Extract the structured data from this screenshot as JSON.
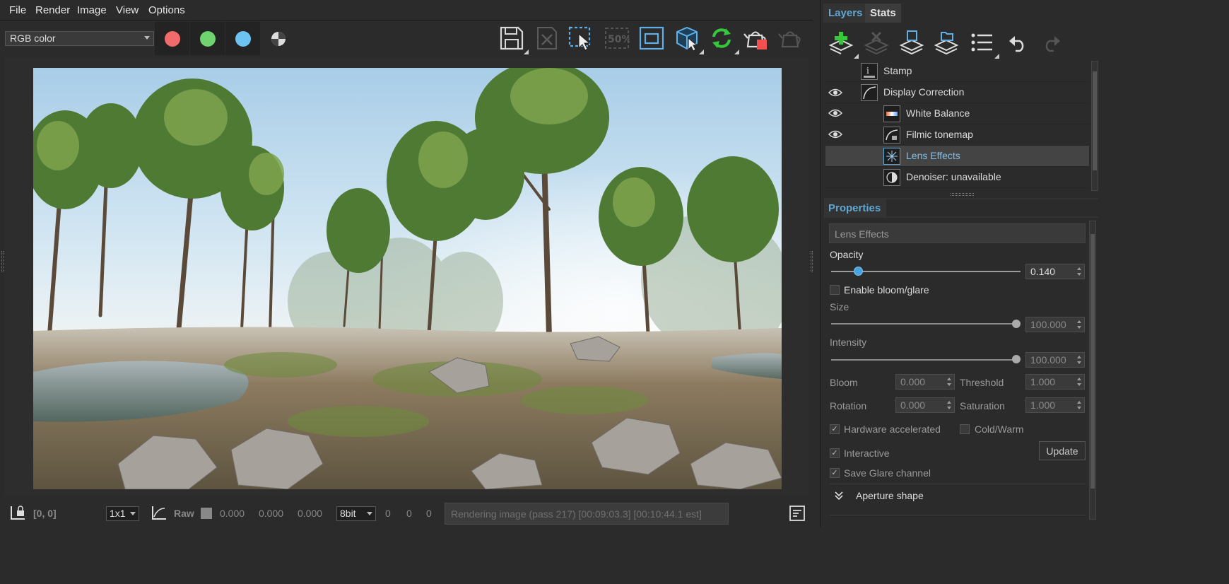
{
  "menu": [
    "File",
    "Render",
    "Image",
    "View",
    "Options"
  ],
  "toolbar": {
    "channel_select": "RGB color",
    "swatches": [
      {
        "name": "red-channel",
        "color": "#f26b6b"
      },
      {
        "name": "green-channel",
        "color": "#6fd36f"
      },
      {
        "name": "blue-channel",
        "color": "#6cc3f2"
      }
    ],
    "icons": [
      "save-icon",
      "discard-icon",
      "region-select-icon",
      "zoom-50-icon",
      "frame-icon",
      "pick-material-icon",
      "refresh-icon",
      "teapot-stop-icon",
      "teapot-icon"
    ],
    "zoom_label": "50%"
  },
  "status": {
    "coords": "[0, 0]",
    "scale": "1x1",
    "raw_label": "Raw",
    "raw_values": [
      "0.000",
      "0.000",
      "0.000"
    ],
    "depth": "8bit",
    "pixel_values": [
      "0",
      "0",
      "0"
    ],
    "progress_text": "Rendering image (pass 217) [00:09:03.3] [00:10:44.1 est]"
  },
  "panel": {
    "tabs": [
      "Layers",
      "Stats"
    ],
    "layer_tools": [
      "add-layer-icon",
      "delete-layer-icon",
      "save-layers-icon",
      "load-layers-icon",
      "layer-list-icon",
      "undo-icon",
      "redo-icon"
    ],
    "layers": [
      {
        "label": "Stamp",
        "indent": 0,
        "visible": false,
        "selected": false,
        "icon": "info-icon"
      },
      {
        "label": "Display Correction",
        "indent": 0,
        "visible": true,
        "selected": false,
        "icon": "curve-icon"
      },
      {
        "label": "White Balance",
        "indent": 1,
        "visible": true,
        "selected": false,
        "icon": "gradient-icon"
      },
      {
        "label": "Filmic tonemap",
        "indent": 1,
        "visible": true,
        "selected": false,
        "icon": "tonemap-icon"
      },
      {
        "label": "Lens Effects",
        "indent": 1,
        "visible": false,
        "selected": true,
        "icon": "sparkle-icon"
      },
      {
        "label": "Denoiser: unavailable",
        "indent": 1,
        "visible": false,
        "selected": false,
        "icon": "denoiser-icon"
      }
    ],
    "properties": {
      "header": "Properties",
      "layer_name": "Lens Effects",
      "opacity_label": "Opacity",
      "opacity_value": "0.140",
      "opacity_fraction": 0.14,
      "enable_bloom_label": "Enable bloom/glare",
      "size_label": "Size",
      "size_value": "100.000",
      "intensity_label": "Intensity",
      "intensity_value": "100.000",
      "bloom_label": "Bloom",
      "bloom_value": "0.000",
      "threshold_label": "Threshold",
      "threshold_value": "1.000",
      "rotation_label": "Rotation",
      "rotation_value": "0.000",
      "saturation_label": "Saturation",
      "saturation_value": "1.000",
      "hw_accel_label": "Hardware accelerated",
      "coldwarm_label": "Cold/Warm",
      "interactive_label": "Interactive",
      "update_label": "Update",
      "save_glare_label": "Save Glare channel",
      "aperture_label": "Aperture shape"
    }
  },
  "colors": {
    "accent": "#5fa8d3",
    "knob": "#4aa3df",
    "green": "#35c93a"
  }
}
